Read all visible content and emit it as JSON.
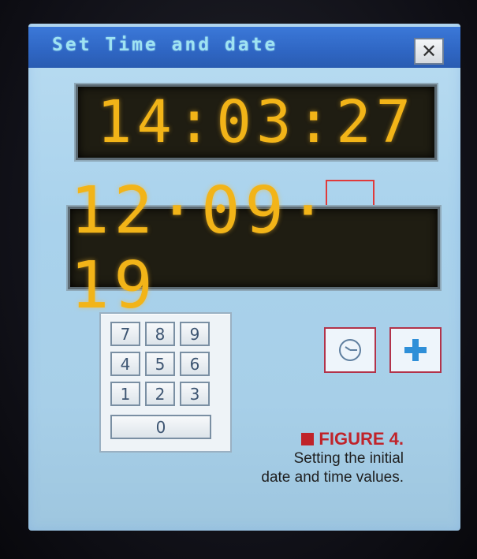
{
  "dialog": {
    "title": "Set Time and date",
    "close_label": "✕"
  },
  "time_display": {
    "value": "14:03:27"
  },
  "date_display": {
    "value": "12·09· 19"
  },
  "keypad": {
    "keys": [
      "7",
      "8",
      "9",
      "4",
      "5",
      "6",
      "1",
      "2",
      "3"
    ],
    "zero": "0"
  },
  "buttons": {
    "clock_icon": "clock-icon",
    "plus_icon": "plus-icon"
  },
  "caption": {
    "figure": "FIGURE 4.",
    "line1": "Setting the initial",
    "line2": "date and time values."
  },
  "colors": {
    "title_bar": "#2f66c3",
    "title_text": "#9fe3f2",
    "lcd_digits": "#f2b418",
    "lcd_bg": "#1f1d12",
    "marker": "#e03a3a",
    "caption_accent": "#c0232a",
    "plus": "#2e8fd8"
  }
}
